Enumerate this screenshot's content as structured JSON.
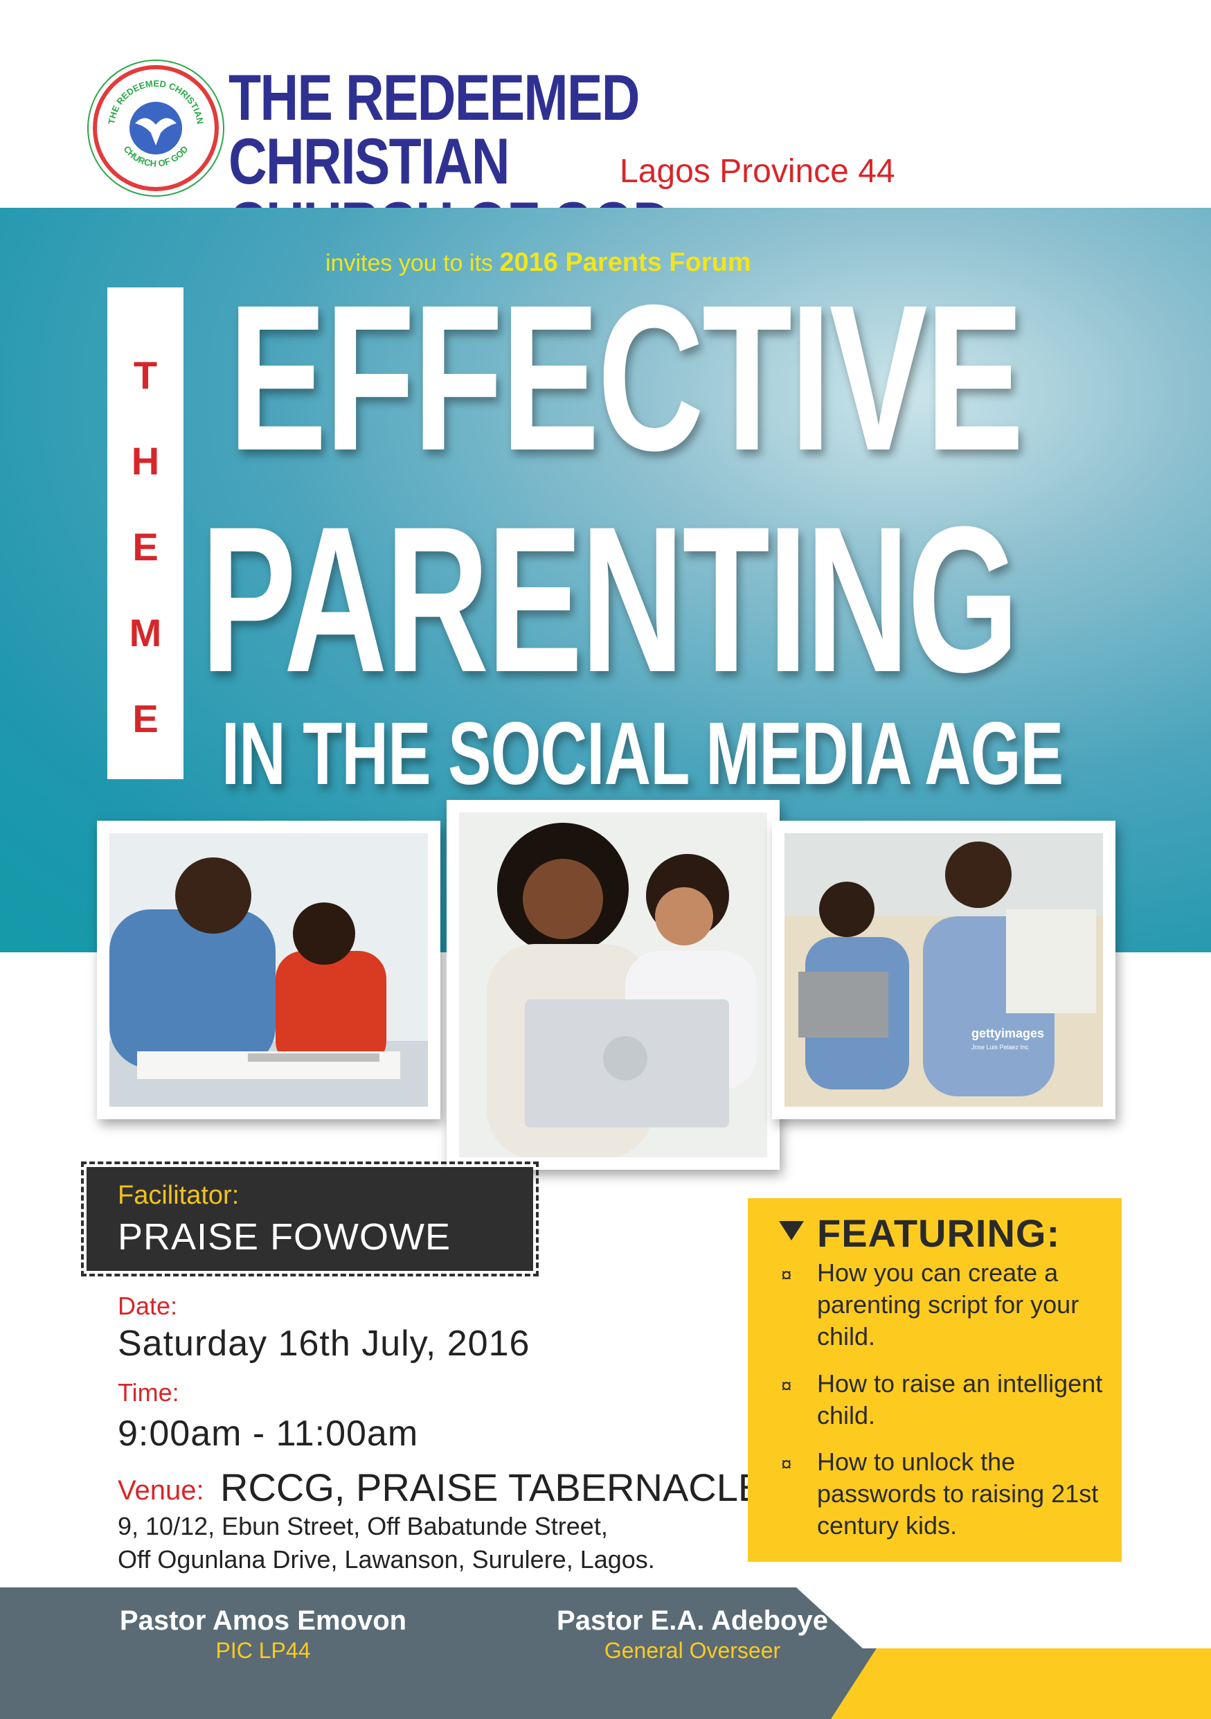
{
  "header": {
    "church_line1": "THE REDEEMED CHRISTIAN",
    "church_line2": "CHURCH OF GOD",
    "province": "Lagos Province 44",
    "logo_text_top": "THE REDEEMED CHRISTIAN",
    "logo_text_bottom": "CHURCH OF GOD"
  },
  "banner": {
    "invite_prefix": "invites you to its ",
    "invite_event": "2016 Parents Forum",
    "theme_label": "THEME",
    "title_line1": "EFFECTIVE",
    "title_line2": "PARENTING",
    "title_line3": "IN THE SOCIAL MEDIA AGE"
  },
  "photos": {
    "watermark": "gettyimages",
    "watermark_credit": "Jose Luis Pelaez Inc"
  },
  "facilitator": {
    "label": "Facilitator:",
    "name": "PRAISE FOWOWE"
  },
  "details": {
    "date_label": "Date:",
    "date_value": "Saturday 16th July, 2016",
    "time_label": "Time:",
    "time_value": "9:00am - 11:00am",
    "venue_label": "Venue:",
    "venue_name": "RCCG, PRAISE TABERNACLE",
    "venue_address_line1": "9, 10/12, Ebun Street, Off Babatunde Street,",
    "venue_address_line2": "Off Ogunlana Drive, Lawanson, Surulere, Lagos."
  },
  "featuring": {
    "title": "FEATURING:",
    "bullet": "¤",
    "items": [
      "How you can create a parenting script for your child.",
      "How to raise an intelligent child.",
      "How to unlock the passwords to raising 21st century kids."
    ]
  },
  "footer": {
    "left_name": "Pastor Amos Emovon",
    "left_role": "PIC LP44",
    "right_name": "Pastor E.A. Adeboye",
    "right_role": "General Overseer"
  },
  "colors": {
    "navy": "#2f3192",
    "red": "#d7262a",
    "teal": "#1f97ad",
    "yellow": "#fdcb20",
    "charcoal": "#2f2f30",
    "slate": "#5a6b76"
  }
}
